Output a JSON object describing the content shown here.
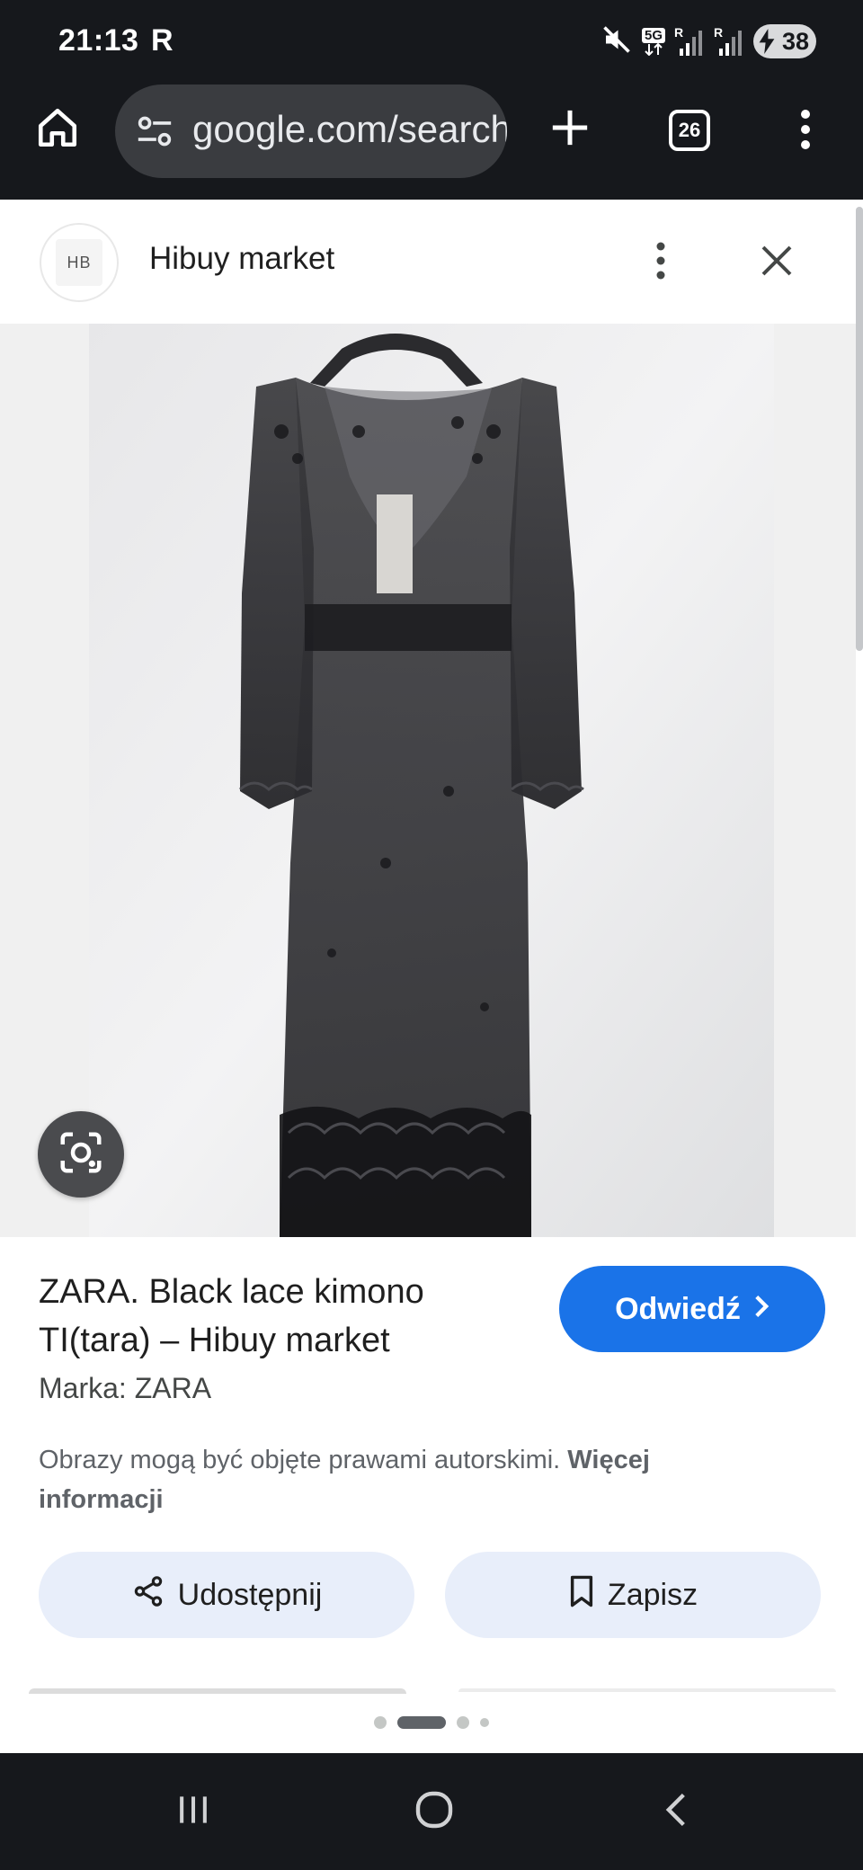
{
  "status_bar": {
    "time": "21:13",
    "indicator": "R",
    "network_label": "5G",
    "signal_label_1": "R",
    "signal_label_2": "R",
    "battery_level": "38",
    "icons": [
      "mute-icon",
      "network-5g-icon",
      "signal-icon",
      "signal-icon",
      "battery-charging-icon"
    ]
  },
  "browser": {
    "url": "google.com/search",
    "tab_count": "26",
    "icons": [
      "home-icon",
      "tune-icon",
      "plus-icon",
      "tab-switcher-icon",
      "more-vert-icon"
    ]
  },
  "source": {
    "favicon_text": "HB",
    "name": "Hibuy market"
  },
  "product": {
    "title": "ZARA. Black lace kimono TI(tara) – Hibuy market",
    "brand": "Marka: ZARA",
    "copyright_text": "Obrazy mogą być objęte prawami autorskimi.",
    "copyright_link": "Więcej informacji",
    "visit_label": "Odwiedź",
    "share_label": "Udostępnij",
    "save_label": "Zapisz"
  },
  "pager": {
    "count": 4,
    "active_index": 1
  },
  "colors": {
    "chrome_dark": "#16181c",
    "omnibox": "#3a3c40",
    "accent_blue": "#1a73e8",
    "tonal_button": "#e8eefa",
    "image_background": "#f0f0f0"
  }
}
